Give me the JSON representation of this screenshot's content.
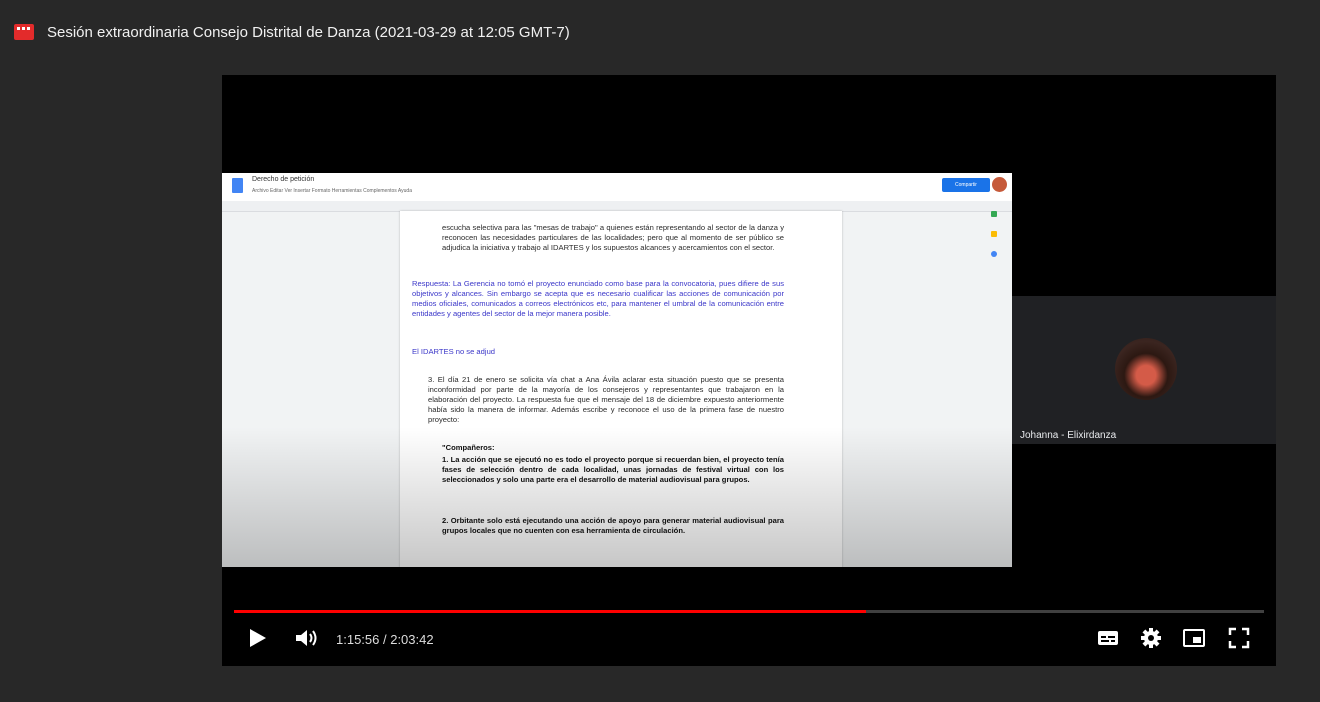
{
  "window": {
    "title": "Sesión extraordinaria Consejo Distrital de Danza (2021-03-29 at 12:05 GMT-7)"
  },
  "document": {
    "name": "Derecho de petición",
    "menus": "Archivo  Editar  Ver  Insertar  Formato  Herramientas  Complementos  Ayuda",
    "share_label": "Compartir",
    "paragraphs": {
      "p1": "escucha selectiva para las \"mesas de trabajo\" a quienes están representando al sector de la danza y reconocen las necesidades particulares de las localidades; pero que al momento de ser público se adjudica la iniciativa y trabajo al IDARTES y los supuestos alcances y acercamientos con el sector.",
      "p2": "Respuesta: La Gerencia no tomó el proyecto enunciado como base para la convocatoria, pues difiere de sus objetivos y alcances. Sin embargo se acepta que es necesario cualificar las acciones de comunicación por medios oficiales, comunicados a correos electrónicos etc, para mantener el umbral de la comunicación entre entidades y agentes del sector de la mejor manera posible.",
      "p3": "El IDARTES no se adjud",
      "p4": "3. El día 21 de enero se solicita vía chat a Ana Ávila aclarar esta situación puesto que se presenta inconformidad por parte de la mayoría de los consejeros y representantes que trabajaron en la elaboración del proyecto. La respuesta fue que el mensaje del 18 de diciembre expuesto anteriormente había sido la manera de informar. Además escribe y reconoce el uso de la primera fase de nuestro proyecto:",
      "p5": "\"Compañeros:",
      "p6": "1. La acción que se ejecutó no es todo el proyecto porque si recuerdan bien, el proyecto tenía fases de selección dentro de cada localidad, unas jornadas de festival virtual con los seleccionados y solo una parte era el desarrollo de material audiovisual para grupos.",
      "p7": "2. Orbitante solo está ejecutando una acción de apoyo para generar material audiovisual para grupos locales que no cuenten con esa herramienta de circulación."
    }
  },
  "participant": {
    "name": "Johanna - Elixirdanza"
  },
  "player": {
    "current_time": "1:15:56",
    "duration": "2:03:42",
    "time_display": "1:15:56 / 2:03:42",
    "progress_fraction": 0.614,
    "accent_color": "#ff0000"
  }
}
